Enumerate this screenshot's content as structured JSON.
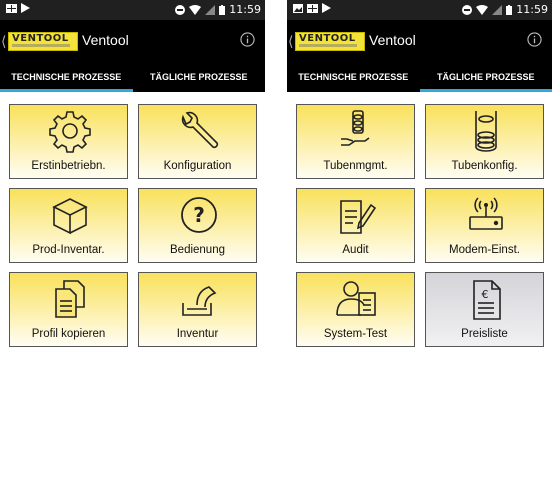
{
  "screens": [
    {
      "status_time": "11:59",
      "app_title": "Ventool",
      "logo_text": "VENTOOL",
      "tabs": [
        {
          "label": "TECHNISCHE PROZESSE",
          "active": true
        },
        {
          "label": "TÄGLICHE PROZESSE",
          "active": false
        }
      ],
      "tiles": [
        {
          "label": "Erstinbetriebn.",
          "icon": "gear-icon"
        },
        {
          "label": "Konfiguration",
          "icon": "wrench-icon"
        },
        {
          "label": "Prod-Inventar.",
          "icon": "box-icon"
        },
        {
          "label": "Bedienung",
          "icon": "question-icon"
        },
        {
          "label": "Profil kopieren",
          "icon": "copy-documents-icon"
        },
        {
          "label": "Inventur",
          "icon": "pour-container-icon"
        }
      ]
    },
    {
      "status_time": "11:59",
      "app_title": "Ventool",
      "logo_text": "VENTOOL",
      "tabs": [
        {
          "label": "TECHNISCHE PROZESSE",
          "active": false
        },
        {
          "label": "TÄGLICHE PROZESSE",
          "active": true
        }
      ],
      "tiles": [
        {
          "label": "Tubenmgmt.",
          "icon": "tube-hand-icon"
        },
        {
          "label": "Tubenkonfig.",
          "icon": "tube-coins-icon"
        },
        {
          "label": "Audit",
          "icon": "document-pen-icon"
        },
        {
          "label": "Modem-Einst.",
          "icon": "modem-icon"
        },
        {
          "label": "System-Test",
          "icon": "person-document-icon"
        },
        {
          "label": "Preisliste",
          "icon": "euro-document-icon",
          "disabled": true
        }
      ]
    }
  ],
  "colors": {
    "tile_top": "#f9e15b",
    "tile_bottom": "#fffdf3",
    "tab_indicator": "#35a7d8",
    "logo_yellow": "#f2e23a"
  }
}
